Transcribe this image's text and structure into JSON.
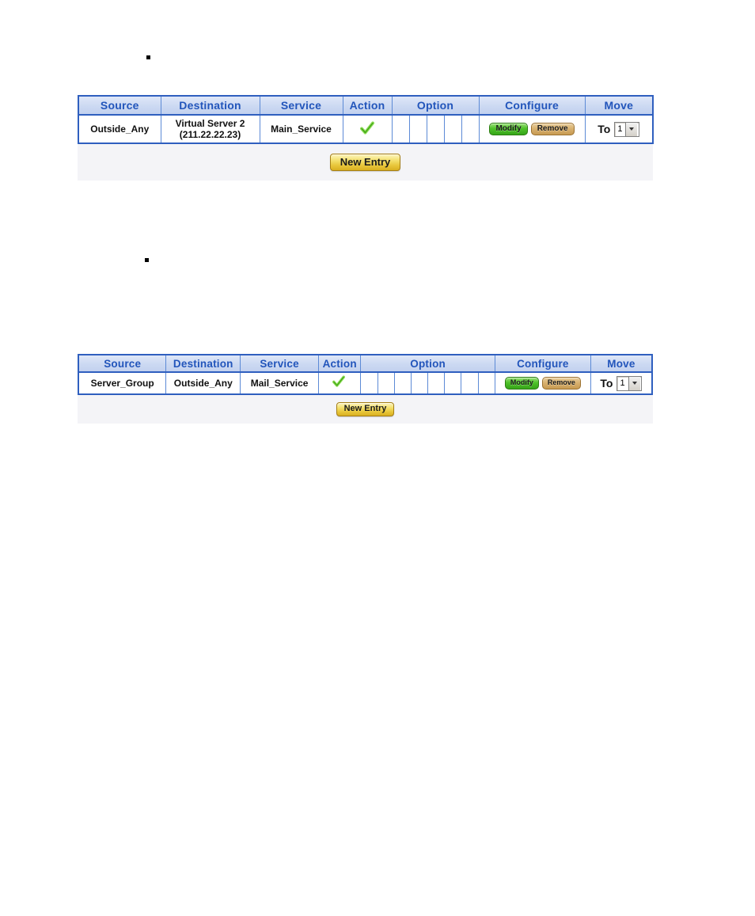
{
  "page": {
    "bullets": [
      "▪",
      "▪"
    ]
  },
  "tables": [
    {
      "id": "policy-table-1",
      "headers": {
        "source": "Source",
        "destination": "Destination",
        "service": "Service",
        "action": "Action",
        "option": "Option",
        "configure": "Configure",
        "move": "Move"
      },
      "option_cell_count": 5,
      "rows": [
        {
          "source": "Outside_Any",
          "destination_line1": "Virtual Server 2",
          "destination_line2": "(211.22.22.23)",
          "service": "Main_Service",
          "action_icon": "green-check-icon",
          "configure": {
            "modify_label": "Modify",
            "remove_label": "Remove"
          },
          "move": {
            "label": "To",
            "selected": "1",
            "options": [
              "1"
            ]
          }
        }
      ],
      "footer": {
        "new_entry_label": "New Entry"
      }
    },
    {
      "id": "policy-table-2",
      "headers": {
        "source": "Source",
        "destination": "Destination",
        "service": "Service",
        "action": "Action",
        "option": "Option",
        "configure": "Configure",
        "move": "Move"
      },
      "option_cell_count": 8,
      "rows": [
        {
          "source": "Server_Group",
          "destination_line1": "Outside_Any",
          "destination_line2": "",
          "service": "Mail_Service",
          "action_icon": "green-check-icon",
          "configure": {
            "modify_label": "Modify",
            "remove_label": "Remove"
          },
          "move": {
            "label": "To",
            "selected": "1",
            "options": [
              "1"
            ]
          }
        }
      ],
      "footer": {
        "new_entry_label": "New Entry"
      }
    }
  ],
  "colors": {
    "header_text": "#2255bb",
    "header_bg": "#ccd9f2",
    "table_border": "#2f5fbf",
    "cell_border": "#5c8ad6",
    "check_green": "#46b31e",
    "modify_green": "#4fc22a",
    "remove_tan": "#d9b271",
    "new_entry_gold": "#e8c63a",
    "footer_bg": "#f4f4f7"
  }
}
